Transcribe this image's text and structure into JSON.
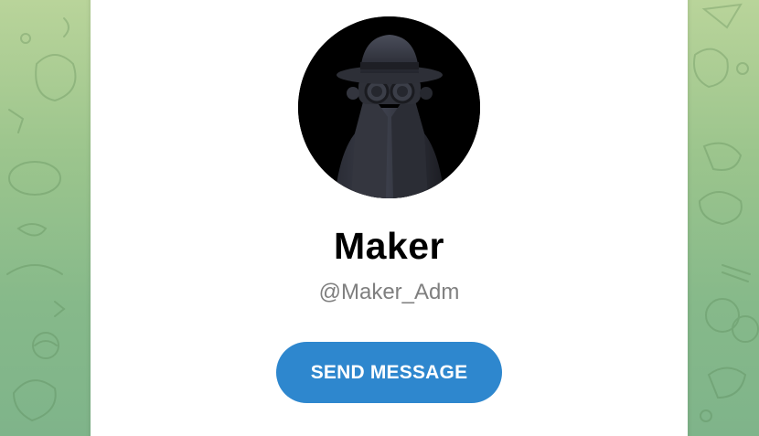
{
  "profile": {
    "name": "Maker",
    "username": "@Maker_Adm",
    "avatar_icon": "spy-figure-avatar"
  },
  "actions": {
    "send_message_label": "SEND MESSAGE"
  },
  "colors": {
    "accent": "#2e87ce",
    "background_top": "#b9d49a",
    "background_bottom": "#7fb48a",
    "card": "#ffffff",
    "username_text": "#7f7f7f"
  }
}
